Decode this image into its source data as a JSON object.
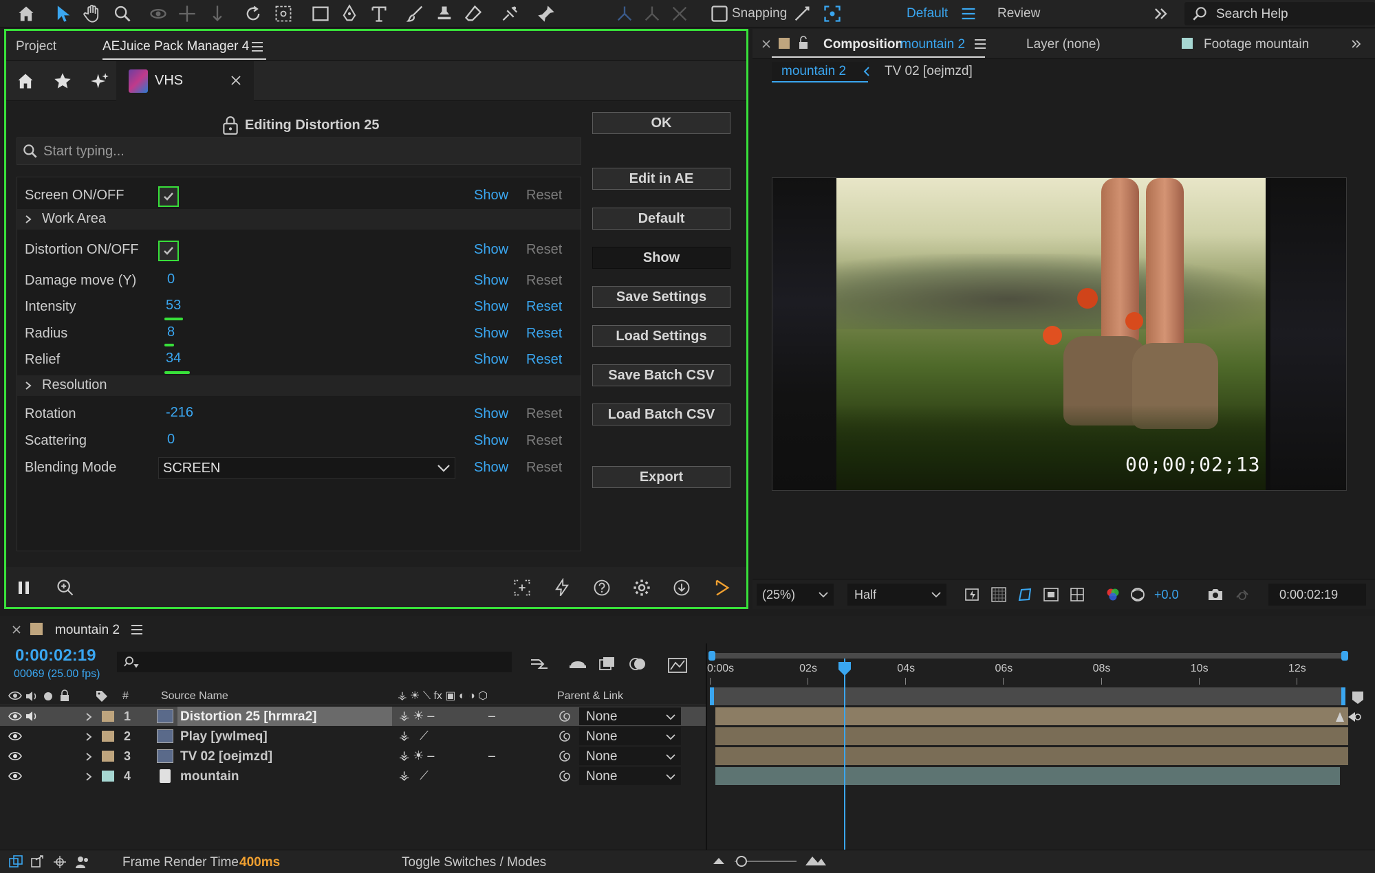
{
  "toolbar": {
    "snapping_label": "Snapping",
    "workspace_default": "Default",
    "workspace_review": "Review",
    "search_placeholder": "Search Help"
  },
  "left_panel": {
    "tabs": [
      "Project",
      "AEJuice Pack Manager 4"
    ],
    "pack_tab_label": "VHS",
    "editing_title": "Editing Distortion 25",
    "search_placeholder": "Start typing...",
    "params": [
      {
        "label": "Screen ON/OFF",
        "type": "checkbox",
        "checked": true,
        "show": "Show",
        "reset": "Reset",
        "reset_active": false
      },
      {
        "label": "Work Area",
        "type": "group"
      },
      {
        "label": "Distortion ON/OFF",
        "type": "checkbox",
        "checked": true,
        "show": "Show",
        "reset": "Reset",
        "reset_active": false
      },
      {
        "label": "Damage move (Y)",
        "value": "0",
        "show": "Show",
        "reset": "Reset",
        "reset_active": false
      },
      {
        "label": "Intensity",
        "value": "53",
        "show": "Show",
        "reset": "Reset",
        "reset_active": true
      },
      {
        "label": "Radius",
        "value": "8",
        "show": "Show",
        "reset": "Reset",
        "reset_active": true
      },
      {
        "label": "Relief",
        "value": "34",
        "show": "Show",
        "reset": "Reset",
        "reset_active": true
      },
      {
        "label": "Resolution",
        "type": "group"
      },
      {
        "label": "Rotation",
        "value": "-216",
        "show": "Show",
        "reset": "Reset",
        "reset_active": false
      },
      {
        "label": "Scattering",
        "value": "0",
        "show": "Show",
        "reset": "Reset",
        "reset_active": false
      },
      {
        "label": "Blending Mode",
        "type": "select",
        "value": "SCREEN",
        "show": "Show",
        "reset": "Reset",
        "reset_active": false
      }
    ],
    "buttons": [
      "OK",
      "Edit in AE",
      "Default",
      "Show",
      "Save Settings",
      "Load Settings",
      "Save Batch CSV",
      "Load Batch CSV",
      "Export"
    ]
  },
  "comp_panel": {
    "tab_composition_prefix": "Composition",
    "tab_composition_name": "mountain 2",
    "tab_layer": "Layer (none)",
    "tab_footage": "Footage mountain",
    "breadcrumb_current": "mountain 2",
    "breadcrumb_next": "TV 02 [oejmzd]",
    "viewer_timecode": "00;00;02;13",
    "zoom": "(25%)",
    "resolution": "Half",
    "exposure": "+0.0",
    "current_time": "0:00:02:19"
  },
  "timeline": {
    "comp_name": "mountain 2",
    "time": "0:00:02:19",
    "frame_info": "00069 (25.00 fps)",
    "columns": {
      "hash": "#",
      "source_name": "Source Name",
      "parent": "Parent & Link"
    },
    "ruler": [
      "0:00s",
      "02s",
      "04s",
      "06s",
      "08s",
      "10s",
      "12s"
    ],
    "playhead_seconds": 2.76,
    "duration_seconds": 13,
    "layers": [
      {
        "num": "1",
        "name": "Distortion 25 [hrmra2]",
        "parent": "None",
        "label_color": "#bfa57e",
        "selected": true
      },
      {
        "num": "2",
        "name": "Play [ywlmeq]",
        "parent": "None",
        "label_color": "#bfa57e",
        "selected": false
      },
      {
        "num": "3",
        "name": "TV 02 [oejmzd]",
        "parent": "None",
        "label_color": "#bfa57e",
        "selected": false
      },
      {
        "num": "4",
        "name": "mountain",
        "parent": "None",
        "label_color": "#a6d7d2",
        "selected": false
      }
    ]
  },
  "status": {
    "frame_render_label": "Frame Render Time",
    "frame_render_value": "400ms",
    "toggle_label": "Toggle Switches / Modes"
  },
  "colors": {
    "accent_blue": "#3aa6f0",
    "highlight_green": "#38e03a",
    "render_orange": "#f0a030"
  }
}
